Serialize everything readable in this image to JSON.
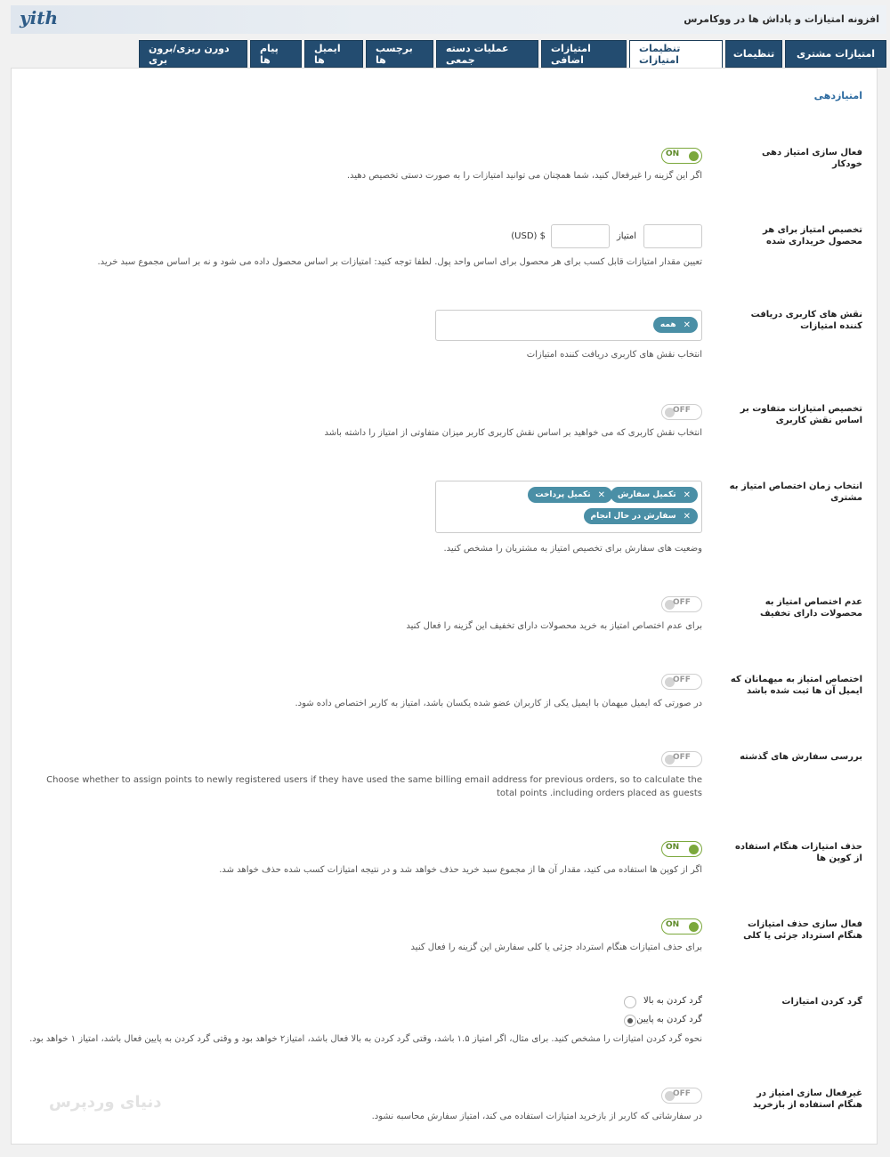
{
  "header": {
    "logo": "yith",
    "title": "افزونه امتیازات و پاداش ها در ووکامرس"
  },
  "tabs": [
    {
      "label": "امتیازات مشتری",
      "active": false
    },
    {
      "label": "تنظیمات",
      "active": false
    },
    {
      "label": "تنظیمات امتیازات",
      "active": true
    },
    {
      "label": "امتیازات اضافی",
      "active": false
    },
    {
      "label": "عملیات دسته جمعی",
      "active": false
    },
    {
      "label": "برچسب ها",
      "active": false
    },
    {
      "label": "ایمیل ها",
      "active": false
    },
    {
      "label": "پیام ها",
      "active": false
    },
    {
      "label": "دورن ریزی/برون بری",
      "active": false
    }
  ],
  "section_title": "امتیازدهی",
  "fields": {
    "auto_points": {
      "label": "فعال سازی امتیاز دهی خودکار",
      "toggle": "ON",
      "desc": "اگر این گزینه را غیرفعال کنید، شما همچنان می توانید امتیازات را به صورت دستی تخصیص دهید."
    },
    "per_product": {
      "label": "تخصیص امتیاز برای هر محصول خریداری شده",
      "points_label": "امتیاز",
      "currency_label": "(USD) $",
      "points_value": "",
      "currency_value": "",
      "desc": "تعیین مقدار امتیازات قابل کسب برای هر محصول برای اساس واحد پول. لطفا توجه کنید: امتیازات بر اساس محصول داده می شود و نه بر اساس مجموع سبد خرید."
    },
    "user_roles": {
      "label": "نقش های کاربری دریافت کننده امتیازات",
      "chips": [
        "همه"
      ],
      "desc": "انتخاب نقش های کاربری دریافت کننده امتیازات"
    },
    "role_points": {
      "label": "تخصیص امتیازات متفاوت بر اساس نقش کاربری",
      "toggle": "OFF",
      "desc": "انتخاب نقش کاربری که می خواهید بر اساس نقش کاربری کاربر میزان متفاوتی از امتیاز را داشته باشد"
    },
    "order_status": {
      "label": "انتخاب زمان اختصاص امتیاز به مشتری",
      "chips": [
        "تکمیل سفارش",
        "تکمیل پرداخت",
        "سفارش در حال انجام"
      ],
      "desc": "وضعیت های سفارش برای تخصیص امتیاز به مشتریان را مشخص کنید."
    },
    "no_discount": {
      "label": "عدم اختصاص امتیاز به محصولات دارای تخفیف",
      "toggle": "OFF",
      "desc": "برای عدم اختصاص امتیاز به خرید محصولات دارای تخفیف این گزینه را فعال کنید"
    },
    "guests": {
      "label": "اختصاص امتیاز به میهمانان که ایمیل آن ها ثبت شده باشد",
      "toggle": "OFF",
      "desc": "در صورتی که ایمیل میهمان با ایمیل یکی از کاربران عضو شده یکسان باشد، امتیاز به کاربر اختصاص داده شود."
    },
    "past_orders": {
      "label": "بررسی سفارش های گذشته",
      "toggle": "OFF",
      "desc": "Choose whether to assign points to newly registered users if they have used the same billing email address for previous orders, so to calculate the total points .including orders placed as guests"
    },
    "coupon_remove": {
      "label": "حذف امتیازات هنگام استفاده از کوپن ها",
      "toggle": "ON",
      "desc": "اگر از کوپن ها استفاده می کنید، مقدار آن ها از مجموع سبد خرید حذف خواهد شد و در نتیجه امتیازات کسب شده حذف خواهد شد."
    },
    "refund_remove": {
      "label": "فعال سازی حذف امتیازات هنگام استرداد جزئی یا کلی",
      "toggle": "ON",
      "desc": "برای حذف امتیازات هنگام استرداد جزئی یا کلی سفارش این گزینه را فعال کنید"
    },
    "rounding": {
      "label": "گرد کردن امتیازات",
      "options": [
        {
          "label": "گرد کردن به بالا",
          "checked": false
        },
        {
          "label": "گرد کردن به پایین",
          "checked": true
        }
      ],
      "desc": "نحوه گرد کردن امتیازات را مشخص کنید. برای مثال، اگر امتیاز ۱.۵ باشد، وقتی گرد کردن به بالا فعال باشد، امتیاز۲ خواهد بود و وقتی گرد کردن به پایین فعال باشد، امتیاز ۱ خواهد بود."
    },
    "redeem_disable": {
      "label": "غیرفعال سازی امتیاز در هنگام استفاده از بازخرید",
      "toggle": "OFF",
      "desc": "در سفارشاتی که کاربر از بازخرید امتیازات استفاده می کند، امتیاز سفارش محاسبه نشود."
    }
  },
  "watermark": "دنیای وردپرس",
  "colors": {
    "tab_bg": "#234c70",
    "accent": "#2d6ba0",
    "chip": "#4a8fa6",
    "toggle_on": "#7ba83c"
  }
}
